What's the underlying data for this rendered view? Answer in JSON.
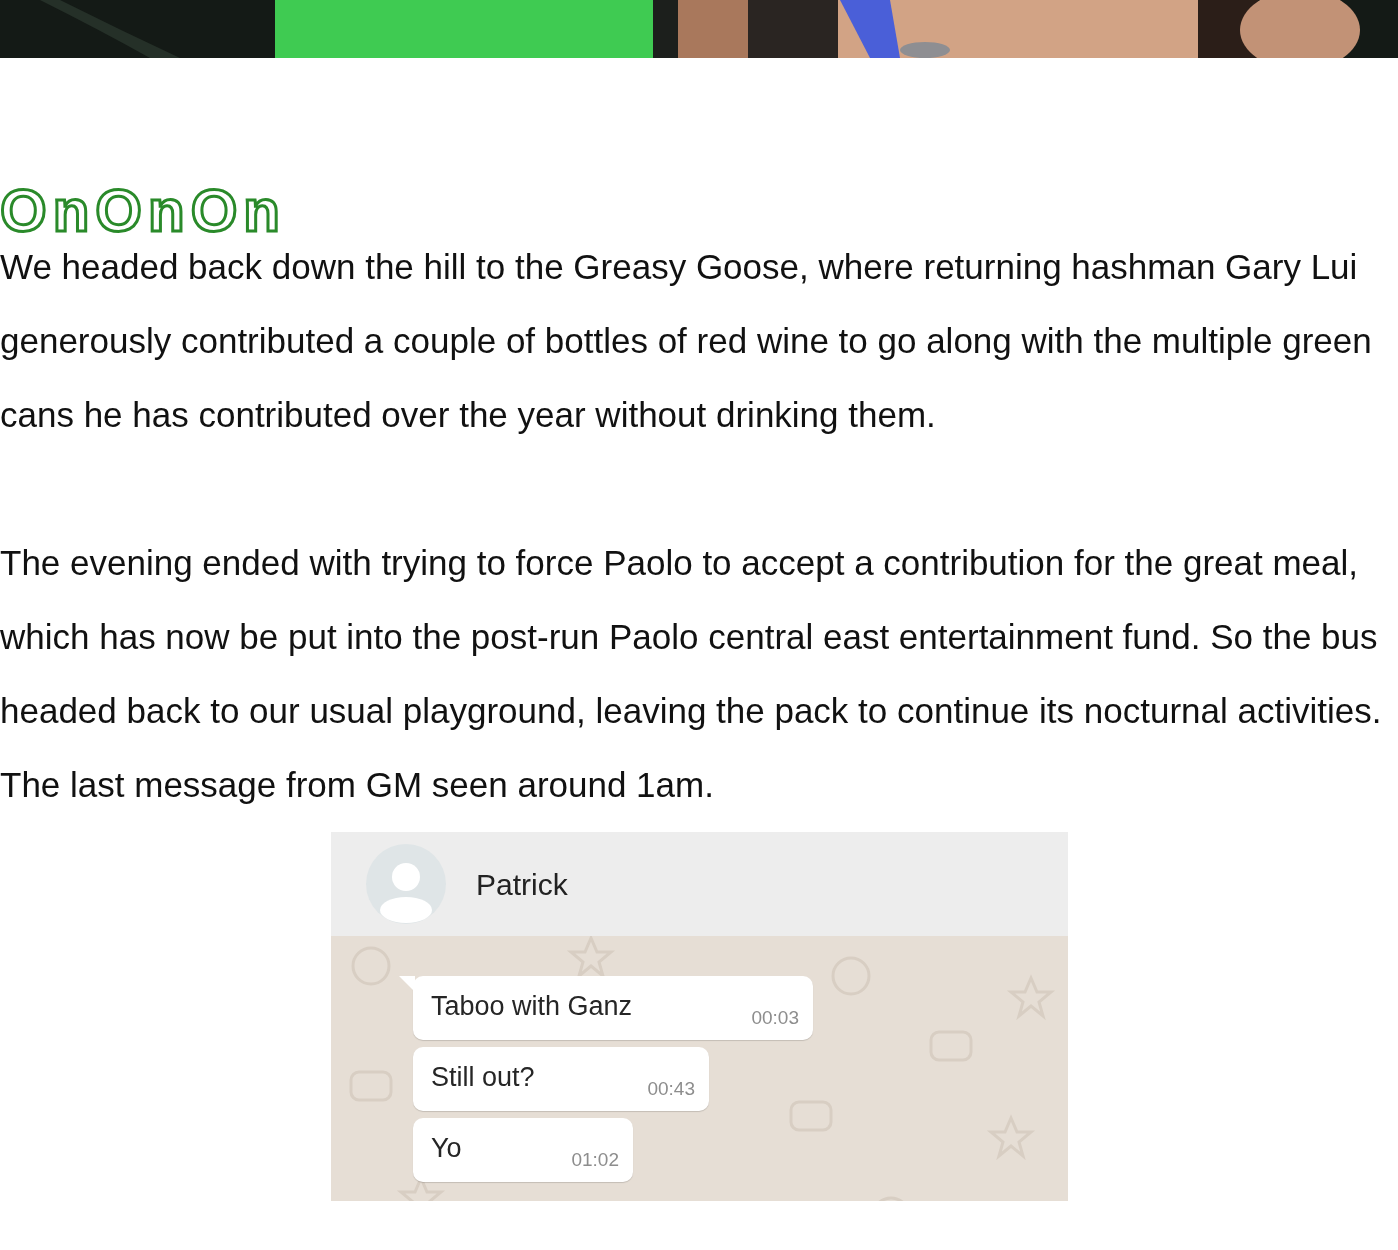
{
  "hero_photo": {
    "kind": "picture"
  },
  "heading": "OnOnOn",
  "paragraphs": [
    "We headed back down the hill to the Greasy Goose, where returning hashman Gary Lui generously contributed a couple of bottles of red wine to go along with the multiple green cans he has contributed over the year without drinking them.",
    "The evening ended with trying to force Paolo to accept a contribution for the great meal, which has now be put into the post-run Paolo central east entertainment fund. So the bus headed back to our usual playground, leaving the pack to continue its nocturnal activities. The last message from GM seen around 1am."
  ],
  "chat": {
    "contact": "Patrick",
    "messages": [
      {
        "text": "Taboo with Ganz",
        "time": "00:03"
      },
      {
        "text": "Still out?",
        "time": "00:43"
      },
      {
        "text": "Yo",
        "time": "01:02"
      }
    ]
  }
}
